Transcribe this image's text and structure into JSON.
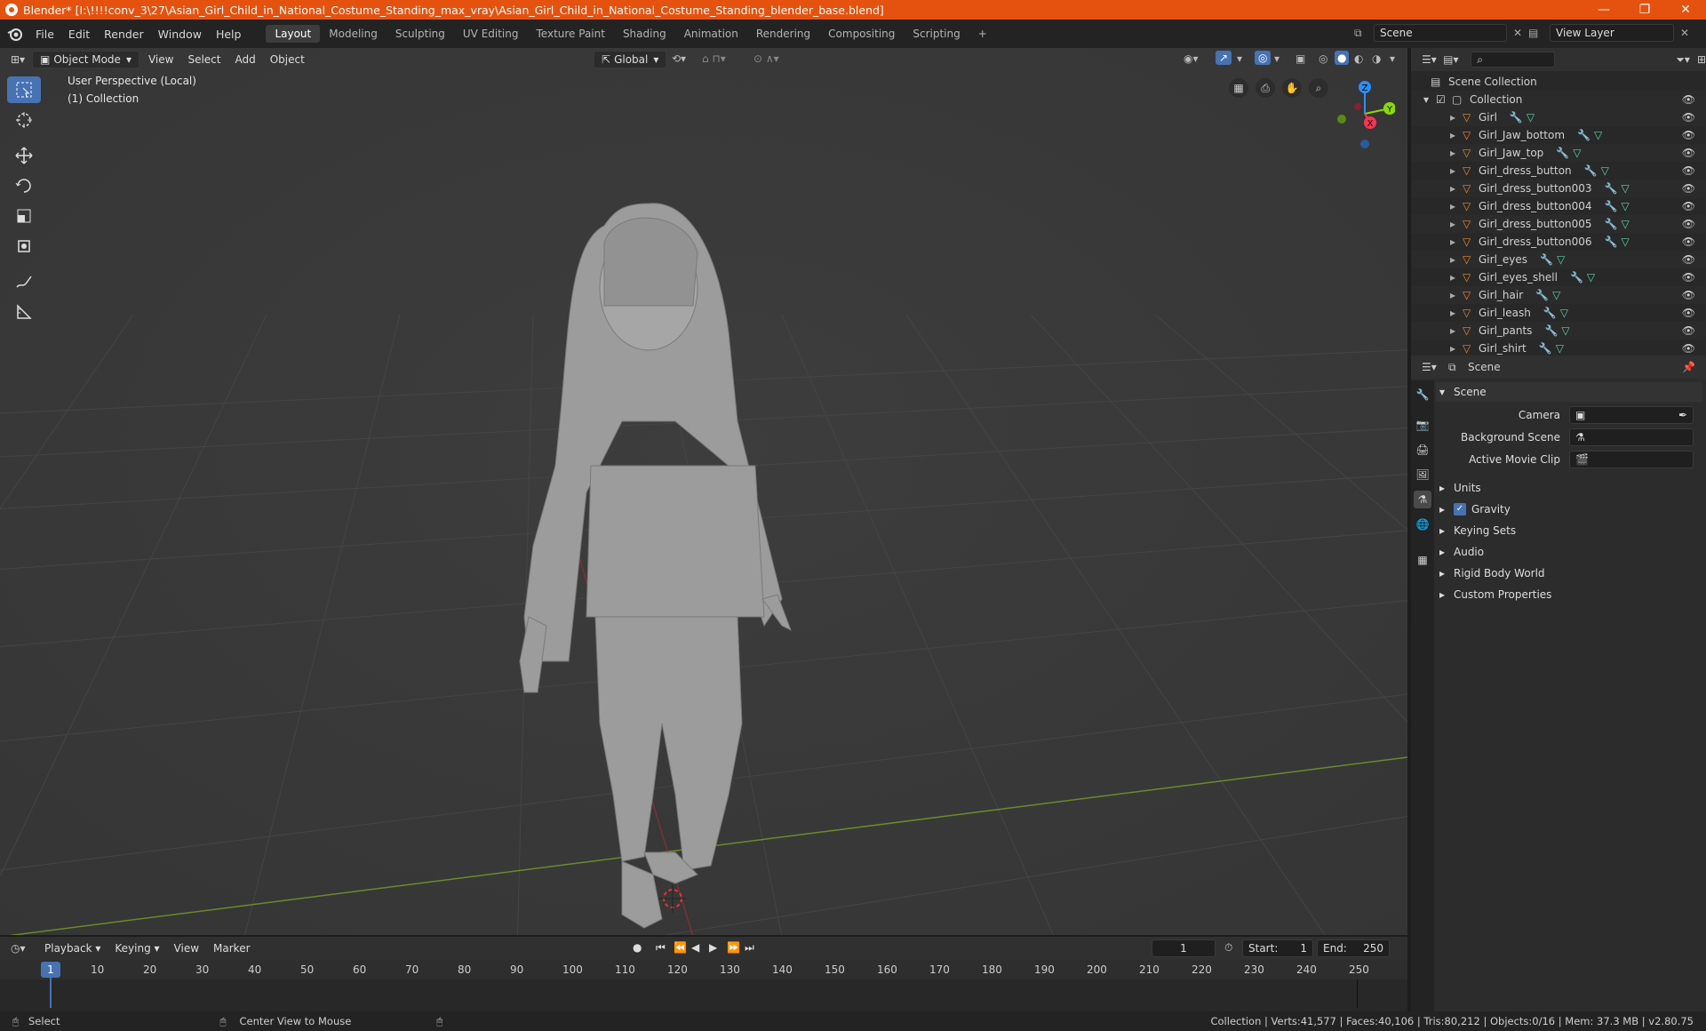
{
  "window": {
    "title": "Blender* [I:\\!!!!conv_3\\27\\Asian_Girl_Child_in_National_Costume_Standing_max_vray\\Asian_Girl_Child_in_National_Costume_Standing_blender_base.blend]",
    "minimize": "—",
    "maximize": "❐",
    "close": "✕"
  },
  "menu": {
    "items": [
      "File",
      "Edit",
      "Render",
      "Window",
      "Help"
    ],
    "workspaces": [
      "Layout",
      "Modeling",
      "Sculpting",
      "UV Editing",
      "Texture Paint",
      "Shading",
      "Animation",
      "Rendering",
      "Compositing",
      "Scripting"
    ],
    "active_workspace": "Layout",
    "add_workspace": "+",
    "scene": "Scene",
    "view_layer": "View Layer"
  },
  "viewport": {
    "mode": "Object Mode",
    "menus": [
      "View",
      "Select",
      "Add",
      "Object"
    ],
    "orientation": "Global",
    "overlay_title": "User Perspective (Local)",
    "overlay_collection": "(1) Collection",
    "gizmo": {
      "z": "Z",
      "y": "Y",
      "x": "X"
    }
  },
  "outliner": {
    "search_placeholder": "",
    "root": "Scene Collection",
    "collection": "Collection",
    "objects": [
      "Girl",
      "Girl_Jaw_bottom",
      "Girl_Jaw_top",
      "Girl_dress_button",
      "Girl_dress_button003",
      "Girl_dress_button004",
      "Girl_dress_button005",
      "Girl_dress_button006",
      "Girl_eyes",
      "Girl_eyes_shell",
      "Girl_hair",
      "Girl_leash",
      "Girl_pants",
      "Girl_shirt"
    ]
  },
  "properties": {
    "context": "Scene",
    "panel_title": "Scene",
    "fields": [
      {
        "label": "Camera",
        "value": ""
      },
      {
        "label": "Background Scene",
        "value": ""
      },
      {
        "label": "Active Movie Clip",
        "value": ""
      }
    ],
    "subpanels": [
      "Units",
      "Gravity",
      "Keying Sets",
      "Audio",
      "Rigid Body World",
      "Custom Properties"
    ],
    "gravity_checked": true
  },
  "timeline": {
    "menus": [
      "Playback",
      "Keying",
      "View",
      "Marker"
    ],
    "current_frame": "1",
    "start_label": "Start:",
    "start": "1",
    "end_label": "End:",
    "end": "250",
    "ticks": [
      "10",
      "20",
      "30",
      "40",
      "50",
      "60",
      "70",
      "80",
      "90",
      "100",
      "110",
      "120",
      "130",
      "140",
      "150",
      "160",
      "170",
      "180",
      "190",
      "200",
      "210",
      "220",
      "230",
      "240",
      "250"
    ],
    "playhead_label": "1"
  },
  "status": {
    "left": "Select",
    "middle": "Center View to Mouse",
    "right": "Collection | Verts:41,577 | Faces:40,106 | Tris:80,212 | Objects:0/16 | Mem: 37.3 MB | v2.80.75"
  },
  "colors": {
    "titlebar": "#e5520f",
    "accent": "#4772b3",
    "x_axis": "#ff3352",
    "y_axis": "#8bdc00",
    "z_axis": "#2890ff"
  }
}
